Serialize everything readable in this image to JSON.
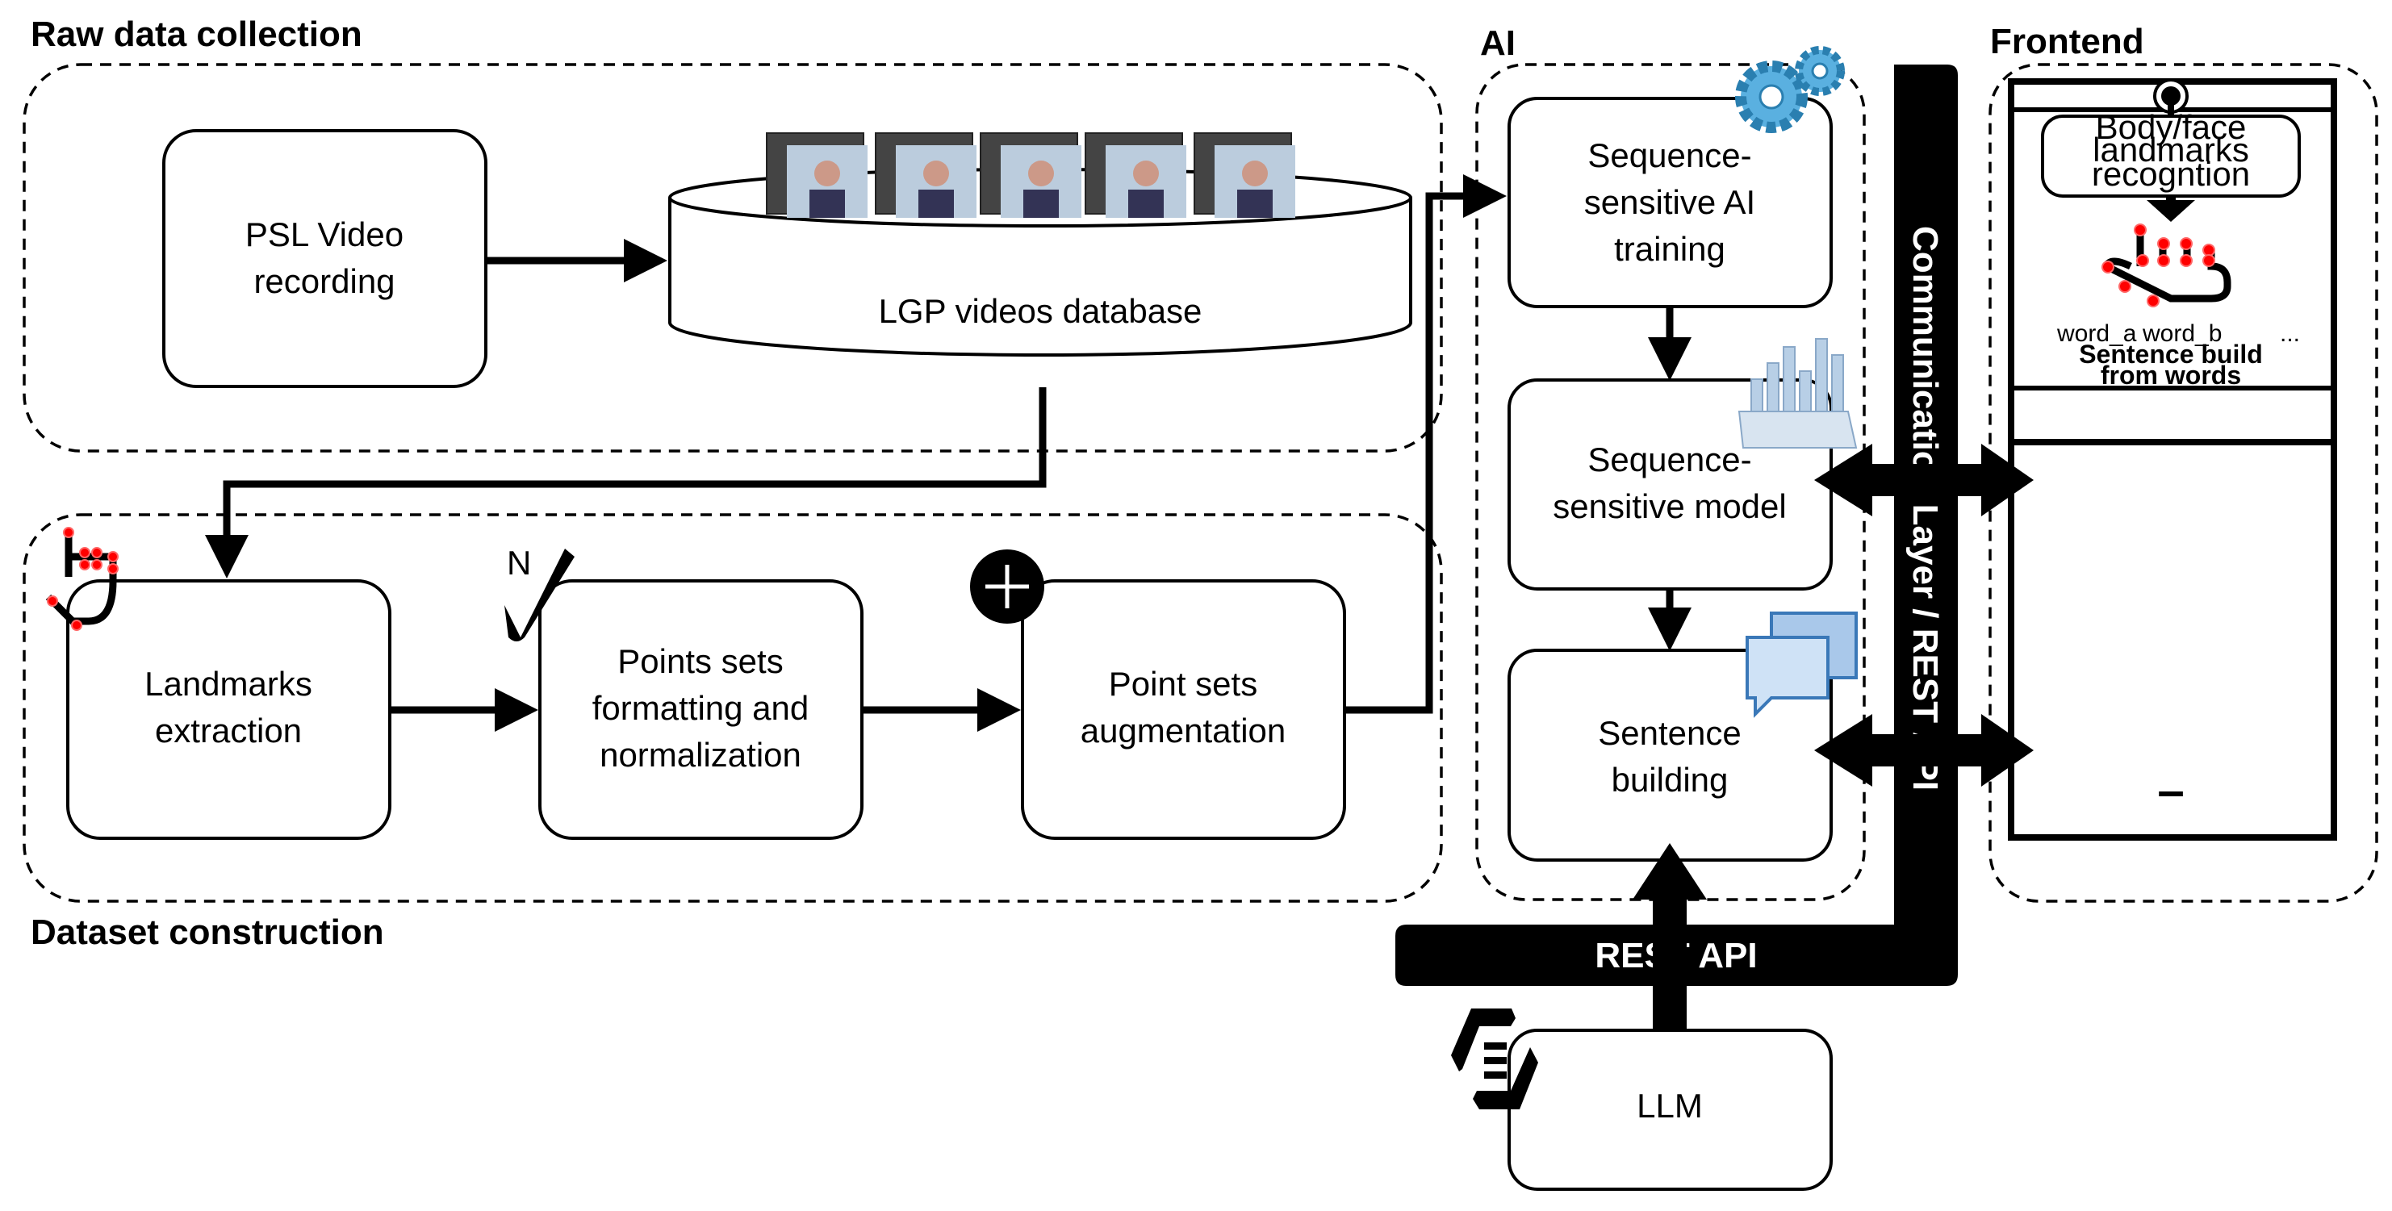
{
  "groups": {
    "raw": "Raw data collection",
    "dataset": "Dataset construction",
    "ai": "AI",
    "frontend": "Frontend"
  },
  "nodes": {
    "psl": [
      "PSL Video",
      "recording"
    ],
    "db": "LGP videos database",
    "landmarks": [
      "Landmarks",
      "extraction"
    ],
    "formatting": [
      "Points sets",
      "formatting and",
      "normalization"
    ],
    "augmentation": [
      "Point sets",
      "augmentation"
    ],
    "training": [
      "Sequence-",
      "sensitive AI",
      "training"
    ],
    "model": [
      "Sequence-",
      "sensitive model"
    ],
    "sentence": [
      "Sentence",
      "building"
    ],
    "llm": "LLM"
  },
  "badges": {
    "normalize_mark": "N"
  },
  "comm_layer": "Communication Layer / REST API",
  "rest_api": "REST API",
  "frontend": {
    "recognition": [
      "Body/face",
      "landmarks",
      "recogntion"
    ],
    "words": [
      "word_a",
      "word_b",
      "..."
    ],
    "sentence": [
      "Sentence build",
      "from words"
    ],
    "bottom_bar": "–"
  }
}
